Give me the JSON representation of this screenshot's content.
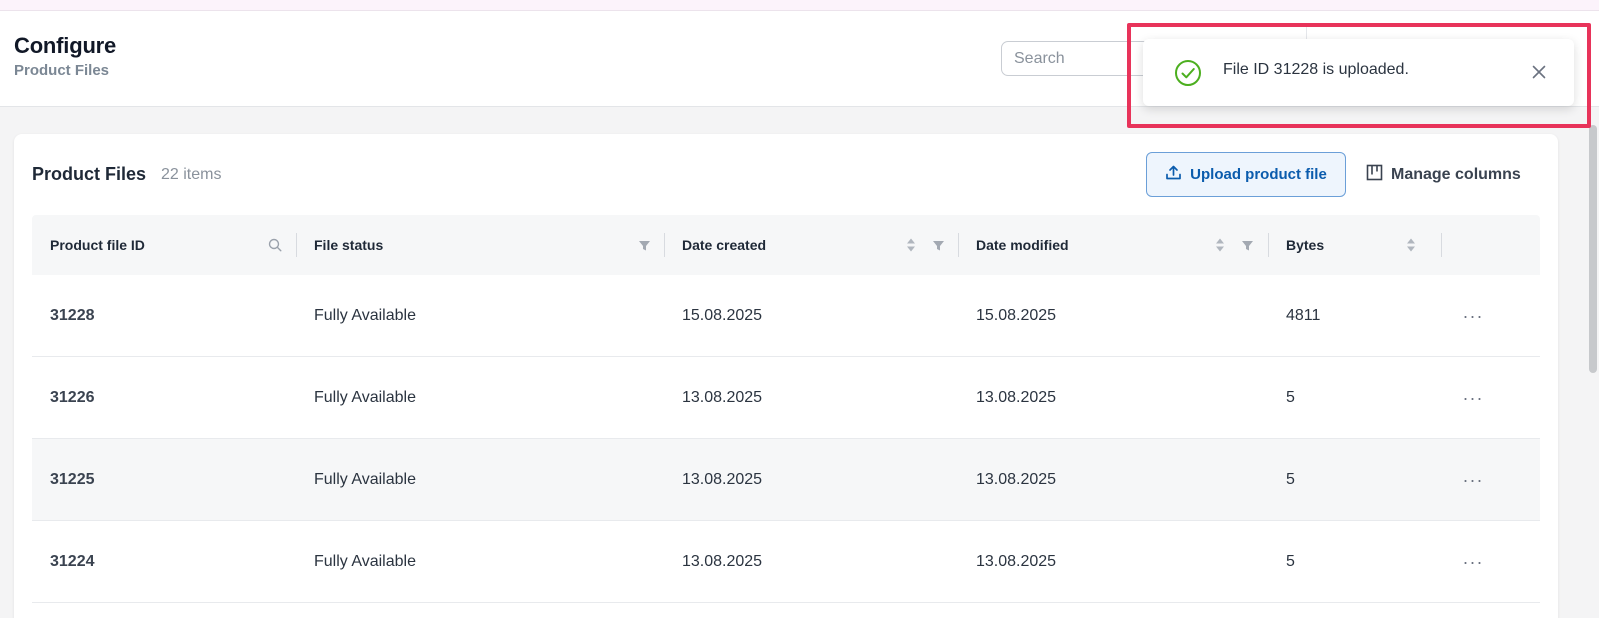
{
  "header": {
    "title": "Configure",
    "subtitle": "Product Files",
    "search_placeholder": "Search"
  },
  "card": {
    "title": "Product Files",
    "count": "22 items",
    "upload_label": "Upload product file",
    "manage_columns_label": "Manage columns"
  },
  "table": {
    "columns": [
      "Product file ID",
      "File status",
      "Date created",
      "Date modified",
      "Bytes"
    ],
    "rows": [
      {
        "id": "31228",
        "status": "Fully Available",
        "created": "15.08.2025",
        "modified": "15.08.2025",
        "bytes": "4811"
      },
      {
        "id": "31226",
        "status": "Fully Available",
        "created": "13.08.2025",
        "modified": "13.08.2025",
        "bytes": "5"
      },
      {
        "id": "31225",
        "status": "Fully Available",
        "created": "13.08.2025",
        "modified": "13.08.2025",
        "bytes": "5"
      },
      {
        "id": "31224",
        "status": "Fully Available",
        "created": "13.08.2025",
        "modified": "13.08.2025",
        "bytes": "5"
      }
    ]
  },
  "toast": {
    "message": "File ID 31228 is uploaded."
  },
  "colors": {
    "accent": "#0b5cad",
    "success": "#4caf1f",
    "highlight": "#e8335a"
  },
  "icons": [
    "search-icon",
    "filter-icon",
    "sort-icon",
    "upload-icon",
    "columns-icon",
    "more-icon",
    "check-circle-icon",
    "close-icon"
  ]
}
